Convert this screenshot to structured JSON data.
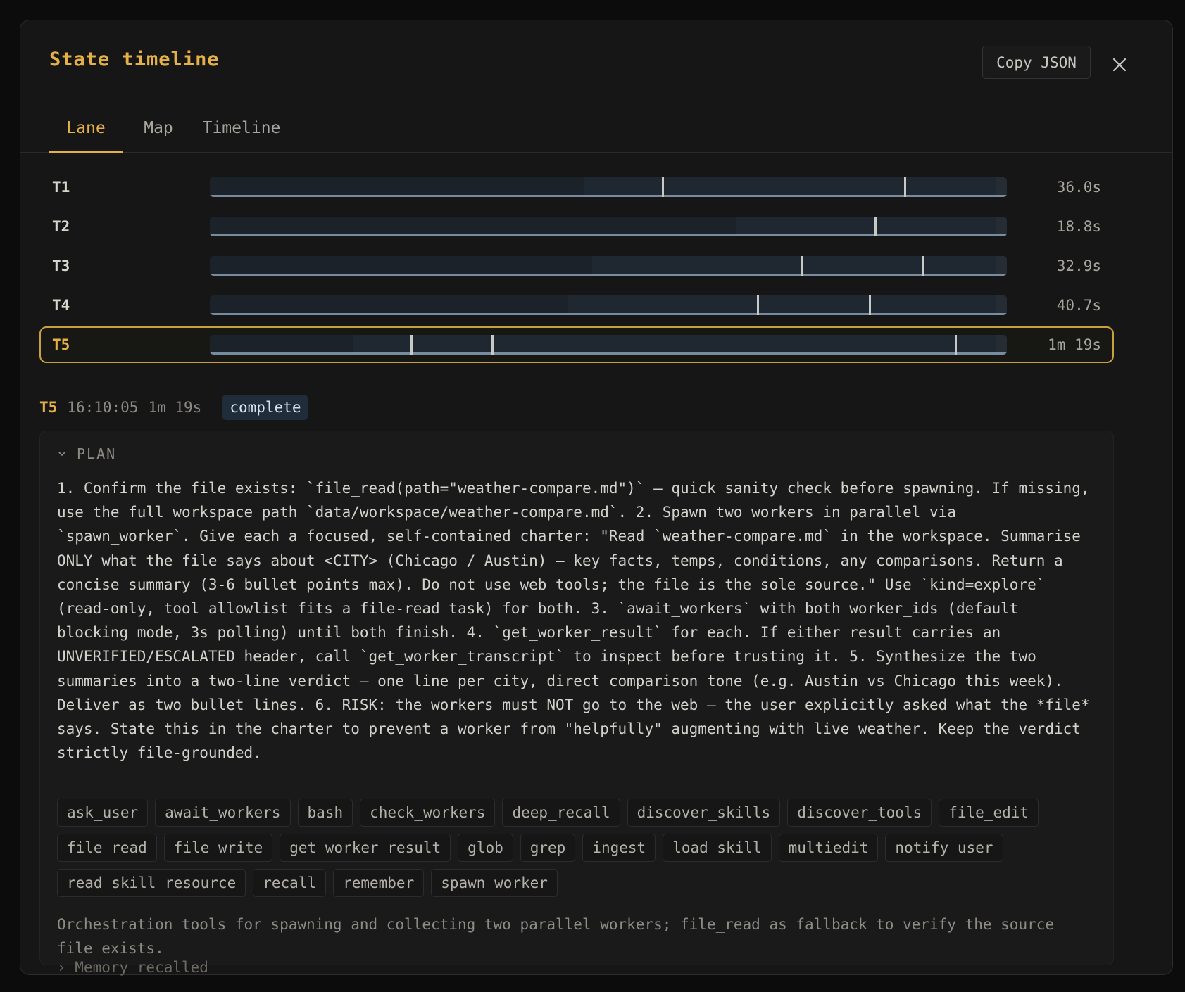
{
  "modal": {
    "title": "State timeline",
    "copy_label": "Copy JSON",
    "close_icon": "close-icon"
  },
  "tabs": [
    {
      "label": "Lane",
      "active": true
    },
    {
      "label": "Map",
      "active": false
    },
    {
      "label": "Timeline",
      "active": false
    }
  ],
  "lanes": [
    {
      "label": "T1",
      "duration": "36.0s",
      "selected": false,
      "dark_fraction": 0.47,
      "ticks": [
        0.567,
        0.871
      ]
    },
    {
      "label": "T2",
      "duration": "18.8s",
      "selected": false,
      "dark_fraction": 0.66,
      "ticks": [
        0.834
      ]
    },
    {
      "label": "T3",
      "duration": "32.9s",
      "selected": false,
      "dark_fraction": 0.48,
      "ticks": [
        0.742,
        0.893
      ]
    },
    {
      "label": "T4",
      "duration": "40.7s",
      "selected": false,
      "dark_fraction": 0.45,
      "ticks": [
        0.686,
        0.827
      ]
    },
    {
      "label": "T5",
      "duration": "1m 19s",
      "selected": true,
      "dark_fraction": 0.18,
      "ticks": [
        0.252,
        0.353,
        0.935
      ]
    }
  ],
  "detail": {
    "id": "T5",
    "time": "16:10:05",
    "duration": "1m 19s",
    "status": "complete"
  },
  "plan": {
    "heading": "PLAN",
    "text": "1. Confirm the file exists: `file_read(path=\"weather-compare.md\")` — quick sanity check before spawning. If missing, use the full workspace path `data/workspace/weather-compare.md`. 2. Spawn two workers in parallel via `spawn_worker`. Give each a focused, self-contained charter: \"Read `weather-compare.md` in the workspace. Summarise ONLY what the file says about <CITY> (Chicago / Austin) — key facts, temps, conditions, any comparisons. Return a concise summary (3-6 bullet points max). Do not use web tools; the file is the sole source.\" Use `kind=explore` (read-only, tool allowlist fits a file-read task) for both. 3. `await_workers` with both worker_ids (default blocking mode, 3s polling) until both finish. 4. `get_worker_result` for each. If either result carries an UNVERIFIED/ESCALATED header, call `get_worker_transcript` to inspect before trusting it. 5. Synthesize the two summaries into a two-line verdict — one line per city, direct comparison tone (e.g. Austin vs Chicago this week). Deliver as two bullet lines. 6. RISK: the workers must NOT go to the web — the user explicitly asked what the *file* says. State this in the charter to prevent a worker from \"helpfully\" augmenting with live weather. Keep the verdict strictly file-grounded.",
    "tools": [
      "ask_user",
      "await_workers",
      "bash",
      "check_workers",
      "deep_recall",
      "discover_skills",
      "discover_tools",
      "file_edit",
      "file_read",
      "file_write",
      "get_worker_result",
      "glob",
      "grep",
      "ingest",
      "load_skill",
      "multiedit",
      "notify_user",
      "read_skill_resource",
      "recall",
      "remember",
      "spawn_worker"
    ],
    "rationale": "Orchestration tools for spawning and collecting two parallel workers; file_read as fallback to verify the source file exists.",
    "cutoff": "› Memory recalled"
  },
  "colors": {
    "accent": "#e4b148",
    "status_bg": "#1f2c3a",
    "bar_fill": "#1f2730",
    "bar_base": "#8fa6bc"
  }
}
